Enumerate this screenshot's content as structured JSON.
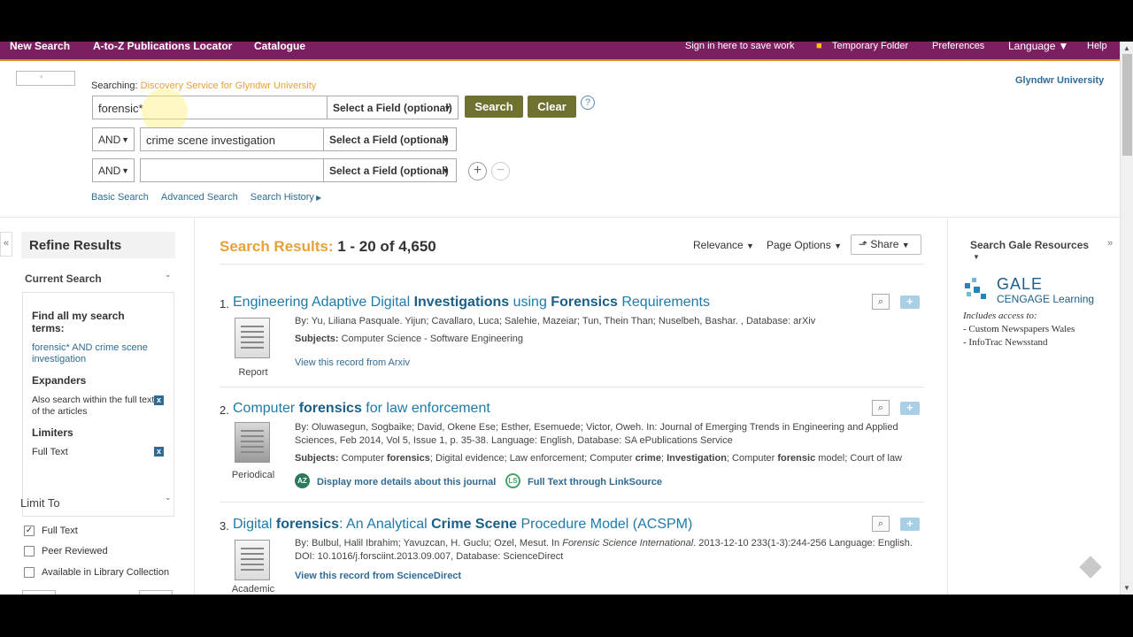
{
  "topnav": {
    "new_search": "New Search",
    "atoz": "A-to-Z Publications Locator",
    "catalogue": "Catalogue",
    "sign_in": "Sign in here to save work",
    "temp_folder": "Temporary Folder",
    "preferences": "Preferences",
    "language": "Language",
    "help": "Help"
  },
  "search": {
    "searching_label": "Searching:",
    "searching_service": "Discovery Service for Glyndwr University",
    "institution": "Glyndwr University",
    "rows": [
      {
        "op": "",
        "value": "forensic*",
        "field": "Select a Field (optional)"
      },
      {
        "op": "AND",
        "value": "crime scene investigation",
        "field": "Select a Field (optional)"
      },
      {
        "op": "AND",
        "value": "",
        "field": "Select a Field (optional)"
      }
    ],
    "search_btn": "Search",
    "clear_btn": "Clear",
    "help_icon": "?",
    "links": {
      "basic": "Basic Search",
      "advanced": "Advanced Search",
      "history": "Search History"
    }
  },
  "refine": {
    "title": "Refine Results",
    "current_search": "Current Search",
    "find_all": "Find all my search terms:",
    "query": "forensic* AND crime scene investigation",
    "expanders": "Expanders",
    "expander_item": "Also search within the full text of the articles",
    "limiters": "Limiters",
    "limiter_item": "Full Text",
    "limit_to": "Limit To",
    "limit_options": [
      {
        "label": "Full Text",
        "checked": true
      },
      {
        "label": "Peer Reviewed",
        "checked": false
      },
      {
        "label": "Available in Library Collection",
        "checked": false
      }
    ]
  },
  "results": {
    "heading": "Search Results:",
    "range": "1 - 20 of 4,650",
    "relevance": "Relevance",
    "page_options": "Page Options",
    "share": "Share",
    "items": [
      {
        "num": "1.",
        "title_parts": [
          "Engineering Adaptive Digital ",
          "Investigations",
          " using ",
          "Forensics",
          " Requirements"
        ],
        "by": "By: Yu, Liliana Pasquale. Yijun; Cavallaro, Luca; Salehie, Mazeiar; Tun, Thein Than; Nuselbeh, Bashar. , Database: arXiv",
        "subjects_label": "Subjects:",
        "subjects": "Computer Science - Software Engineering",
        "link": "View this record from Arxiv",
        "type": "Report"
      },
      {
        "num": "2.",
        "title_parts": [
          "Computer ",
          "forensics",
          " for law enforcement"
        ],
        "by": "By: Oluwasegun, Sogbaike; David, Okene Ese; Esther, Esemuede; Victor, Oweh. In: Journal of Emerging Trends in Engineering and Applied Sciences, Feb 2014, Vol 5, Issue 1, p. 35-38. Language: English, Database: SA ePublications Service",
        "subjects_label": "Subjects:",
        "subjects_parts": [
          "Computer ",
          "forensics",
          "; Digital evidence; Law enforcement; Computer ",
          "crime",
          "; ",
          "Investigation",
          "; Computer ",
          "forensic",
          " model; Court of law"
        ],
        "link_journal": "Display more details about this journal",
        "link_fulltext": "Full Text through LinkSource",
        "az_badge": "AZ",
        "ls_badge": "LS",
        "type": "Periodical"
      },
      {
        "num": "3.",
        "title_parts": [
          "Digital ",
          "forensics",
          ": An Analytical ",
          "Crime Scene",
          " Procedure Model (ACSPM)"
        ],
        "by_parts": [
          "By: Bulbul, Halil Ibrahim; Yavuzcan, H. Guclu; Ozel, Mesut. In ",
          "Forensic Science International",
          ". 2013-12-10 233(1-3):244-256 Language: English. DOI: 10.1016/j.forsciint.2013.09.007, Database: ScienceDirect"
        ],
        "link": "View this record from ScienceDirect",
        "type": "Academic"
      }
    ]
  },
  "gale": {
    "title": "Search Gale Resources",
    "logo_main": "GALE",
    "logo_sub": "CENGAGE Learning",
    "includes": "Includes access to:",
    "items": [
      "- Custom Newspapers Wales",
      "- InfoTrac Newsstand"
    ]
  },
  "colors": {
    "nav_bg": "#7b1f61",
    "nav_border": "#e08a2e",
    "accent_orange": "#e8a13a",
    "btn_olive": "#6f7130",
    "link_blue": "#2f6b94"
  }
}
